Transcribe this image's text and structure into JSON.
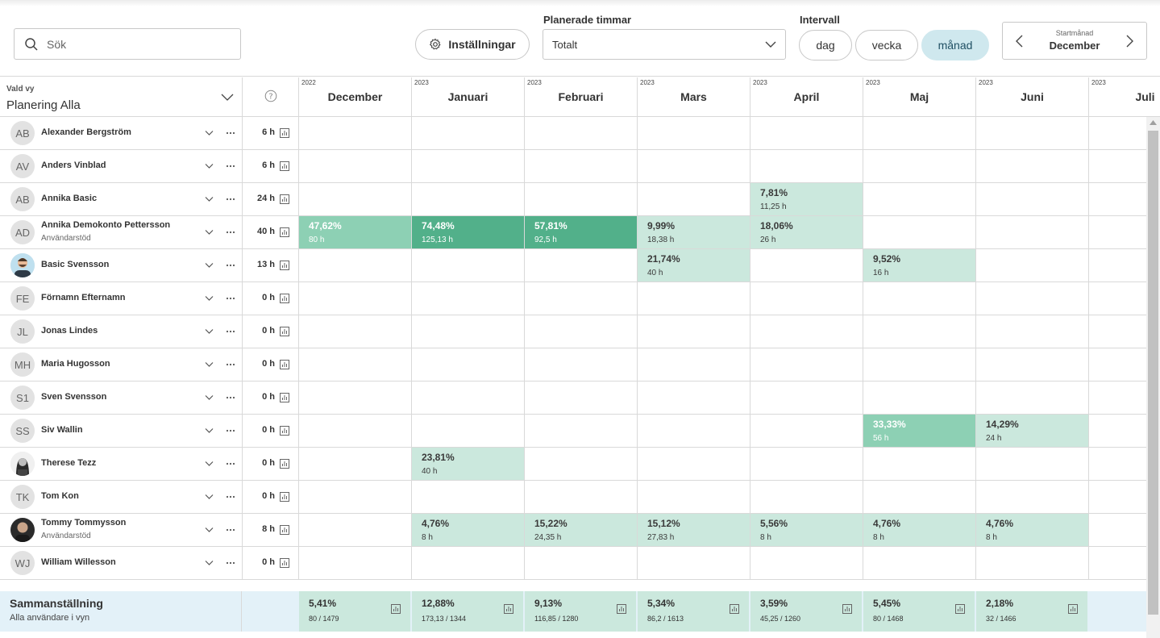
{
  "search": {
    "placeholder": "Sök"
  },
  "toolbar": {
    "settings_label": "Inställningar",
    "planned_hours_label": "Planerade timmar",
    "planned_hours_value": "Totalt",
    "interval_label": "Intervall",
    "intervals": [
      "dag",
      "vecka",
      "månad"
    ],
    "active_interval": "månad",
    "start_month_label": "Startmånad",
    "start_month_value": "December"
  },
  "view": {
    "label": "Vald vy",
    "name": "Planering Alla"
  },
  "months": [
    {
      "year": "2022",
      "name": "December"
    },
    {
      "year": "2023",
      "name": "Januari"
    },
    {
      "year": "2023",
      "name": "Februari"
    },
    {
      "year": "2023",
      "name": "Mars"
    },
    {
      "year": "2023",
      "name": "April"
    },
    {
      "year": "2023",
      "name": "Maj"
    },
    {
      "year": "2023",
      "name": "Juni"
    },
    {
      "year": "2023",
      "name": "Juli"
    }
  ],
  "users": [
    {
      "initials": "AB",
      "name": "Alexander Bergström",
      "sub": "",
      "hours": "6 h",
      "cells": {}
    },
    {
      "initials": "AV",
      "name": "Anders Vinblad",
      "sub": "",
      "hours": "6 h",
      "cells": {}
    },
    {
      "initials": "AB",
      "name": "Annika Basic",
      "sub": "",
      "hours": "24 h",
      "cells": {
        "4": {
          "pct": "7,81%",
          "hrs": "11,25 h",
          "level": 1
        }
      }
    },
    {
      "initials": "AD",
      "name": "Annika Demokonto Pettersson",
      "sub": "Användarstöd",
      "hours": "40 h",
      "cells": {
        "0": {
          "pct": "47,62%",
          "hrs": "80 h",
          "level": 2
        },
        "1": {
          "pct": "74,48%",
          "hrs": "125,13 h",
          "level": 3
        },
        "2": {
          "pct": "57,81%",
          "hrs": "92,5 h",
          "level": 3
        },
        "3": {
          "pct": "9,99%",
          "hrs": "18,38 h",
          "level": 1
        },
        "4": {
          "pct": "18,06%",
          "hrs": "26 h",
          "level": 1
        }
      }
    },
    {
      "initials": "",
      "photo": "man-blue",
      "name": "Basic Svensson",
      "sub": "",
      "hours": "13 h",
      "cells": {
        "3": {
          "pct": "21,74%",
          "hrs": "40 h",
          "level": 1
        },
        "5": {
          "pct": "9,52%",
          "hrs": "16 h",
          "level": 1
        }
      }
    },
    {
      "initials": "FE",
      "name": "Förnamn Efternamn",
      "sub": "",
      "hours": "0 h",
      "cells": {}
    },
    {
      "initials": "JL",
      "name": "Jonas Lindes",
      "sub": "",
      "hours": "0 h",
      "cells": {}
    },
    {
      "initials": "MH",
      "name": "Maria Hugosson",
      "sub": "",
      "hours": "0 h",
      "cells": {}
    },
    {
      "initials": "S1",
      "name": "Sven Svensson",
      "sub": "",
      "hours": "0 h",
      "cells": {}
    },
    {
      "initials": "SS",
      "name": "Siv Wallin",
      "sub": "",
      "hours": "0 h",
      "cells": {
        "5": {
          "pct": "33,33%",
          "hrs": "56 h",
          "level": 2
        },
        "6": {
          "pct": "14,29%",
          "hrs": "24 h",
          "level": 1
        }
      }
    },
    {
      "initials": "",
      "photo": "woman-bw",
      "name": "Therese Tezz",
      "sub": "",
      "hours": "0 h",
      "cells": {
        "1": {
          "pct": "23,81%",
          "hrs": "40 h",
          "level": 1
        }
      }
    },
    {
      "initials": "TK",
      "name": "Tom Kon",
      "sub": "",
      "hours": "0 h",
      "cells": {}
    },
    {
      "initials": "",
      "photo": "man-dark",
      "name": "Tommy Tommysson",
      "sub": "Användarstöd",
      "hours": "8 h",
      "cells": {
        "1": {
          "pct": "4,76%",
          "hrs": "8 h",
          "level": 1
        },
        "2": {
          "pct": "15,22%",
          "hrs": "24,35 h",
          "level": 1
        },
        "3": {
          "pct": "15,12%",
          "hrs": "27,83 h",
          "level": 1
        },
        "4": {
          "pct": "5,56%",
          "hrs": "8 h",
          "level": 1
        },
        "5": {
          "pct": "4,76%",
          "hrs": "8 h",
          "level": 1
        },
        "6": {
          "pct": "4,76%",
          "hrs": "8 h",
          "level": 1
        }
      }
    },
    {
      "initials": "WJ",
      "name": "William Willesson",
      "sub": "",
      "hours": "0 h",
      "cells": {}
    }
  ],
  "summary": {
    "title": "Sammanställning",
    "subtitle": "Alla användare i vyn",
    "cells": [
      {
        "pct": "5,41%",
        "ratio": "80 / 1479"
      },
      {
        "pct": "12,88%",
        "ratio": "173,13 / 1344"
      },
      {
        "pct": "9,13%",
        "ratio": "116,85 / 1280"
      },
      {
        "pct": "5,34%",
        "ratio": "86,2 / 1613"
      },
      {
        "pct": "3,59%",
        "ratio": "45,25 / 1260"
      },
      {
        "pct": "5,45%",
        "ratio": "80 / 1468"
      },
      {
        "pct": "2,18%",
        "ratio": "32 / 1466"
      }
    ]
  },
  "colors": {
    "level1": "#cbe8dd",
    "level2": "#8dd0b4",
    "level3": "#52b08a",
    "active_pill": "#cfe8ee",
    "summary_bg": "#e3f1f8"
  }
}
